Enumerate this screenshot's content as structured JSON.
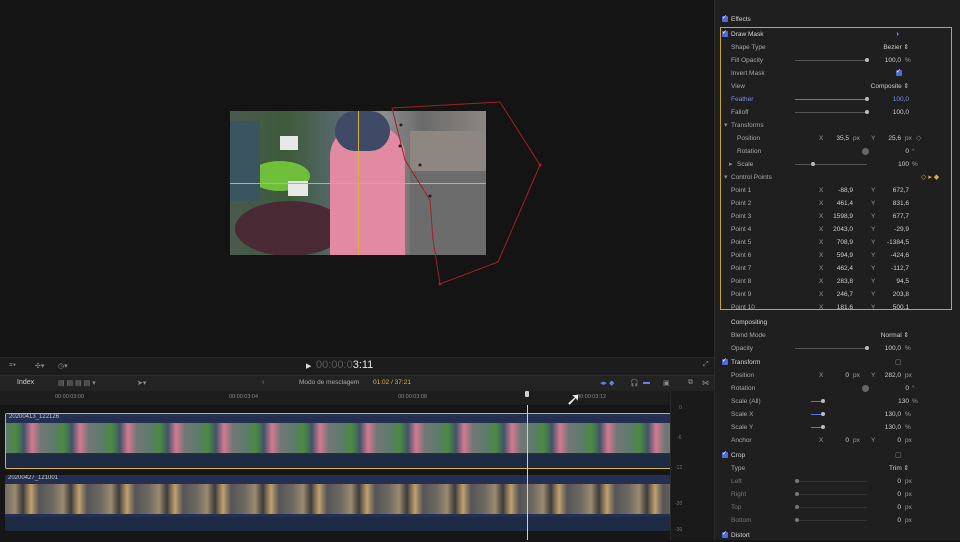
{
  "viewer": {
    "timecode": "00:00:03:11",
    "timecode_dim": "00:00:0",
    "timecode_bright": "3:11"
  },
  "timeline_header": {
    "index_label": "Index",
    "mode_label": "Modo de mesclagem",
    "position": "01:02 / 37:21"
  },
  "ruler": {
    "ticks": [
      "00:00:03:00",
      "00:00:03:04",
      "00:00:03:08",
      "00:00:03:12"
    ]
  },
  "tracks": {
    "clip1_name": "20200413_122126",
    "clip2_name": "20200427_121001"
  },
  "meter_labels": [
    "0",
    "-6",
    "-12",
    "-20",
    "-30"
  ],
  "inspector": {
    "effects_label": "Effects",
    "draw_mask": {
      "title": "Draw Mask",
      "rows": [
        {
          "label": "Shape Type",
          "value": "Bezier ⇕"
        },
        {
          "label": "Fill Opacity",
          "value": "100,0",
          "unit": "%"
        },
        {
          "label": "Invert Mask",
          "value": ""
        },
        {
          "label": "View",
          "value": "Composite ⇕"
        },
        {
          "label": "Feather",
          "value": "100,0"
        },
        {
          "label": "Falloff",
          "value": "100,0"
        }
      ],
      "transforms_label": "Transforms",
      "position": {
        "label": "Position",
        "x": "35,5",
        "x_unit": "px",
        "y": "25,6",
        "y_unit": "px"
      },
      "rotation": {
        "label": "Rotation",
        "value": "0",
        "unit": "°"
      },
      "scale": {
        "label": "Scale",
        "value": "100",
        "unit": "%"
      },
      "control_points_label": "Control Points",
      "points": [
        {
          "label": "Point 1",
          "x": "-88,9",
          "y": "672,7"
        },
        {
          "label": "Point 2",
          "x": "461,4",
          "y": "831,6"
        },
        {
          "label": "Point 3",
          "x": "1598,9",
          "y": "677,7"
        },
        {
          "label": "Point 4",
          "x": "2043,0",
          "y": "-29,9"
        },
        {
          "label": "Point 5",
          "x": "708,9",
          "y": "-1384,5"
        },
        {
          "label": "Point 6",
          "x": "594,9",
          "y": "-424,6"
        },
        {
          "label": "Point 7",
          "x": "462,4",
          "y": "-112,7"
        },
        {
          "label": "Point 8",
          "x": "283,8",
          "y": "94,5"
        },
        {
          "label": "Point 9",
          "x": "246,7",
          "y": "203,8"
        },
        {
          "label": "Point 10",
          "x": "181,6",
          "y": "500,1"
        }
      ]
    },
    "compositing": {
      "title": "Compositing",
      "blend_mode_label": "Blend Mode",
      "blend_mode_value": "Normal ⇕",
      "opacity_label": "Opacity",
      "opacity_value": "100,0",
      "opacity_unit": "%"
    },
    "transform": {
      "title": "Transform",
      "position": {
        "label": "Position",
        "x": "0",
        "x_unit": "px",
        "y": "282,0",
        "y_unit": "px"
      },
      "rotation": {
        "label": "Rotation",
        "value": "0",
        "unit": "°"
      },
      "scale_all": {
        "label": "Scale (All)",
        "value": "130",
        "unit": "%"
      },
      "scale_x": {
        "label": "Scale X",
        "value": "130,0",
        "unit": "%"
      },
      "scale_y": {
        "label": "Scale Y",
        "value": "130,0",
        "unit": "%"
      },
      "anchor": {
        "label": "Anchor",
        "x": "0",
        "x_unit": "px",
        "y": "0",
        "y_unit": "px"
      }
    },
    "crop": {
      "title": "Crop",
      "type_label": "Type",
      "type_value": "Trim ⇕",
      "rows": [
        {
          "label": "Left",
          "value": "0",
          "unit": "px"
        },
        {
          "label": "Right",
          "value": "0",
          "unit": "px"
        },
        {
          "label": "Top",
          "value": "0",
          "unit": "px"
        },
        {
          "label": "Bottom",
          "value": "0",
          "unit": "px"
        }
      ]
    },
    "distort_title": "Distort"
  },
  "colors": {
    "accent_blue": "#4f6bd8",
    "selection_gold": "#c8a62c",
    "mask_red": "#a0202a"
  }
}
